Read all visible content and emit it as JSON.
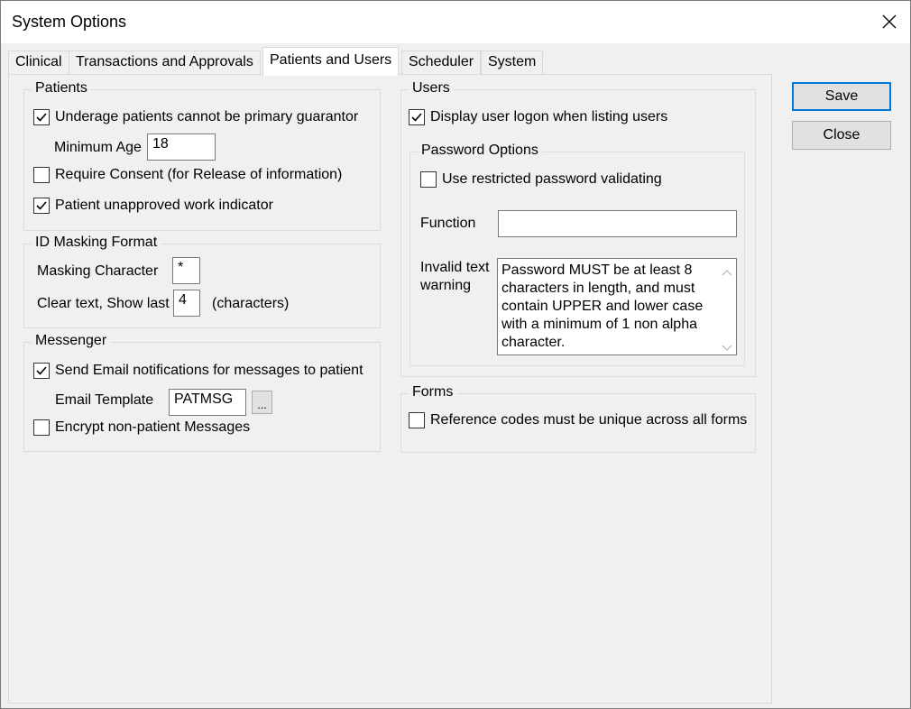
{
  "window": {
    "title": "System Options"
  },
  "tabs": [
    {
      "label": "Clinical",
      "active": false
    },
    {
      "label": "Transactions and Approvals",
      "active": false
    },
    {
      "label": "Patients and Users",
      "active": true
    },
    {
      "label": "Scheduler",
      "active": false
    },
    {
      "label": "System",
      "active": false
    }
  ],
  "patients": {
    "group_label": "Patients",
    "underage": {
      "label": "Underage patients cannot be primary guarantor",
      "checked": true
    },
    "min_age": {
      "label": "Minimum Age",
      "value": "18"
    },
    "require_consent": {
      "label": "Require Consent (for Release of information)",
      "checked": false
    },
    "unapproved_work": {
      "label": "Patient unapproved work indicator",
      "checked": true
    }
  },
  "id_masking": {
    "group_label": "ID Masking Format",
    "masking_char": {
      "label": "Masking Character",
      "value": "*"
    },
    "clear_text": {
      "label": "Clear text, Show last",
      "value": "4",
      "suffix": "(characters)"
    }
  },
  "messenger": {
    "group_label": "Messenger",
    "send_email": {
      "label": "Send Email notifications for messages to patient",
      "checked": true
    },
    "email_template": {
      "label": "Email Template",
      "value": "PATMSG",
      "browse_label": "..."
    },
    "encrypt": {
      "label": "Encrypt non-patient Messages",
      "checked": false
    }
  },
  "users": {
    "group_label": "Users",
    "display_logon": {
      "label": "Display user logon when listing users",
      "checked": true
    },
    "password_options": {
      "group_label": "Password Options",
      "restricted": {
        "label": "Use restricted password validating",
        "checked": false
      },
      "function": {
        "label": "Function",
        "value": ""
      },
      "invalid_text": {
        "label_line1": "Invalid text",
        "label_line2": "warning",
        "value": "Password MUST be at least 8 characters in length, and must contain UPPER and lower case with a minimum of 1 non alpha character."
      }
    }
  },
  "forms": {
    "group_label": "Forms",
    "unique_codes": {
      "label": "Reference codes must be unique across all forms",
      "checked": false
    }
  },
  "buttons": {
    "save": "Save",
    "close": "Close"
  },
  "colors": {
    "accent": "#0078d7",
    "background": "#f0f0f0"
  }
}
